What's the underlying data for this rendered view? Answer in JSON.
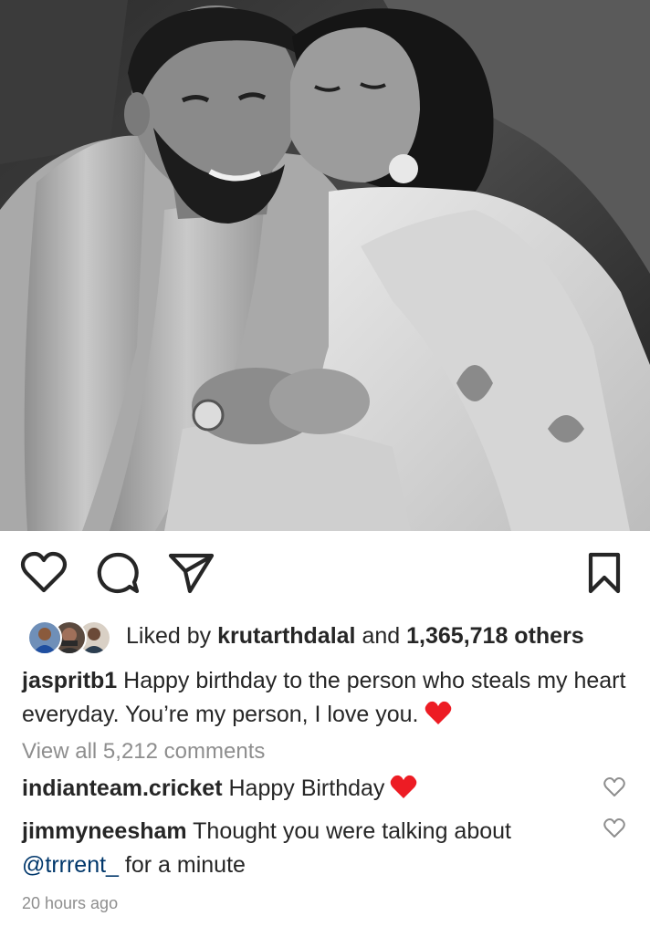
{
  "post": {
    "image_alt": "Black and white photo of a woman kissing a smiling bearded man on the cheek"
  },
  "actions": {
    "like_icon": "heart-outline-icon",
    "comment_icon": "comment-bubble-icon",
    "share_icon": "paper-plane-icon",
    "save_icon": "bookmark-icon"
  },
  "likes": {
    "prefix": "Liked by",
    "user": "krutarthdalal",
    "conjunction": "and",
    "count": "1,365,718 others"
  },
  "caption": {
    "username": "jaspritb1",
    "text": "Happy birthday to the person who steals my heart everyday. You’re my person, I love you.",
    "emoji": "red-heart-emoji"
  },
  "view_comments": "View all 5,212 comments",
  "comments": [
    {
      "username": "indianteam.cricket",
      "text": "Happy Birthday",
      "emoji": "red-heart-emoji"
    },
    {
      "username": "jimmyneesham",
      "text": "Thought you were talking about",
      "mention": "@trrrent_",
      "text_after": "for a minute"
    }
  ],
  "timestamp": "20 hours ago",
  "colors": {
    "text": "#262626",
    "secondary": "#8e8e8e",
    "mention": "#00376b",
    "heart": "#ed1c24"
  }
}
